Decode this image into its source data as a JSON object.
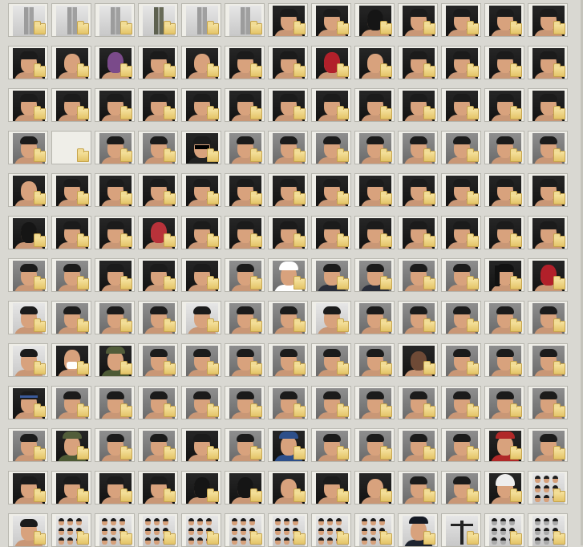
{
  "window": {
    "title": "",
    "view": "thumbnails"
  },
  "colors": {
    "background": "#d9d8d2",
    "tile": "#efeee8",
    "folder": "#f0d27f",
    "skin": "#d8a27d"
  },
  "grid": {
    "columns": 13,
    "rows": 13,
    "items": [
      "legs-gray",
      "legs-gray",
      "legs-gray",
      "legs-camo",
      "legs-gray",
      "legs-gray",
      "face-dark",
      "face-dark",
      "mask-black",
      "face-dark",
      "face-dark",
      "face-dark",
      "face-dark",
      "face-dark",
      "face-bald",
      "mask-purple",
      "face-dark",
      "face-bald",
      "face-dark",
      "face-dark",
      "mask-red",
      "face-bald",
      "face-dark",
      "face-dark",
      "face-dark",
      "face-dark",
      "face-dark",
      "face-dark",
      "face-dark",
      "face-dark",
      "face-dark",
      "face-dark",
      "face-dark",
      "face-dark",
      "face-dark",
      "face-dark",
      "face-dark",
      "face-dark",
      "face-dark",
      "face-gray",
      "folder-only",
      "face-gray",
      "face-gray",
      "sunglasses",
      "face-gray",
      "face-gray",
      "face-gray",
      "face-gray",
      "face-gray",
      "face-gray",
      "face-gray",
      "face-gray",
      "face-bald",
      "face-dark",
      "face-dark",
      "face-dark",
      "face-dark",
      "face-dark",
      "face-dark",
      "face-dark",
      "face-dark",
      "face-dark",
      "face-dark",
      "face-dark",
      "face-dark",
      "mask-black",
      "face-dark",
      "face-dark",
      "mask-green",
      "face-dark",
      "face-dark",
      "face-dark",
      "face-dark",
      "face-dark",
      "face-dark",
      "face-dark",
      "face-dark",
      "face-dark",
      "face-gray",
      "face-gray",
      "face-dark",
      "face-dark",
      "face-dark",
      "face-gray",
      "chef",
      "suit",
      "suit",
      "face-gray",
      "face-gray",
      "long-hair",
      "mask-red",
      "face-light",
      "face-gray",
      "face-gray",
      "face-gray",
      "face-light",
      "face-gray",
      "face-gray",
      "face-light",
      "face-gray",
      "face-gray",
      "face-gray",
      "face-gray",
      "face-gray",
      "face-light",
      "mask-white",
      "hooded",
      "face-gray",
      "face-gray",
      "face-gray",
      "face-gray",
      "face-gray",
      "face-gray",
      "face-dark-skin",
      "face-gray",
      "face-gray",
      "face-gray",
      "face-headband",
      "face-gray",
      "face-gray",
      "face-gray",
      "face-gray",
      "face-gray",
      "face-gray",
      "face-gray",
      "face-gray",
      "face-gray",
      "face-gray",
      "face-gray",
      "face-gray",
      "face-gray",
      "face-beanie",
      "face-gray",
      "face-gray",
      "face-dark",
      "face-gray",
      "cap-blue",
      "face-gray",
      "face-gray",
      "face-gray",
      "face-gray",
      "cap-red",
      "face-gray",
      "face-dark",
      "face-dark",
      "face-dark",
      "face-dark",
      "mask-black",
      "mask-black",
      "face-bald",
      "face-dark",
      "face-bald",
      "face-gray",
      "face-gray",
      "helmet",
      "sheet-dark",
      "face-light",
      "sheet-white",
      "sheet-white",
      "sheet-white",
      "sheet-white",
      "sheet-white",
      "sheet-white",
      "sheet-white",
      "sheet-white",
      "officer",
      "figure-t",
      "sheet-mesh",
      "sheet-mesh"
    ]
  }
}
